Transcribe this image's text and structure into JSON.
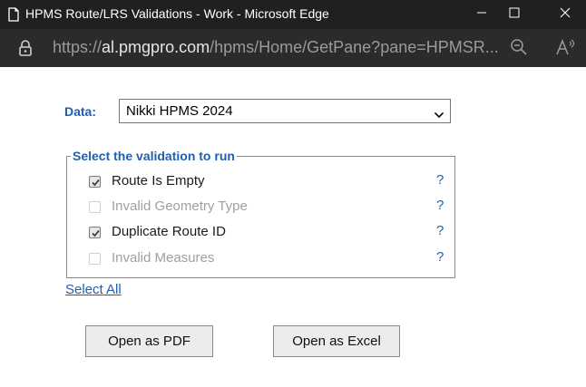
{
  "window": {
    "title": "HPMS Route/LRS Validations - Work - Microsoft Edge",
    "icon": "edge-page-icon",
    "controls": [
      "minimize-icon",
      "maximize-icon",
      "close-icon"
    ]
  },
  "address_bar": {
    "url_prefix": "https://",
    "url_host": "al.pmgpro.com",
    "url_path": "/hpms/Home/GetPane?pane=HPMSR...",
    "lock_icon": "lock-icon",
    "zoom_icon": "zoom-out-icon",
    "read_icon": "read-aloud-icon"
  },
  "form": {
    "data_label": "Data:",
    "data_selected": "Nikki HPMS 2024",
    "legend": "Select the validation to run",
    "validations": [
      {
        "label": "Route Is Empty",
        "checked": true,
        "disabled": false,
        "help": "?"
      },
      {
        "label": "Invalid Geometry Type",
        "checked": false,
        "disabled": true,
        "help": "?"
      },
      {
        "label": "Duplicate Route ID",
        "checked": true,
        "disabled": false,
        "help": "?"
      },
      {
        "label": "Invalid Measures",
        "checked": false,
        "disabled": true,
        "help": "?"
      }
    ],
    "select_all": "Select All",
    "open_pdf": "Open as PDF",
    "open_excel": "Open as Excel"
  },
  "colors": {
    "accent_blue": "#1f5fae",
    "titlebar_bg": "#202020",
    "addressbar_bg": "#2b2b2b"
  }
}
